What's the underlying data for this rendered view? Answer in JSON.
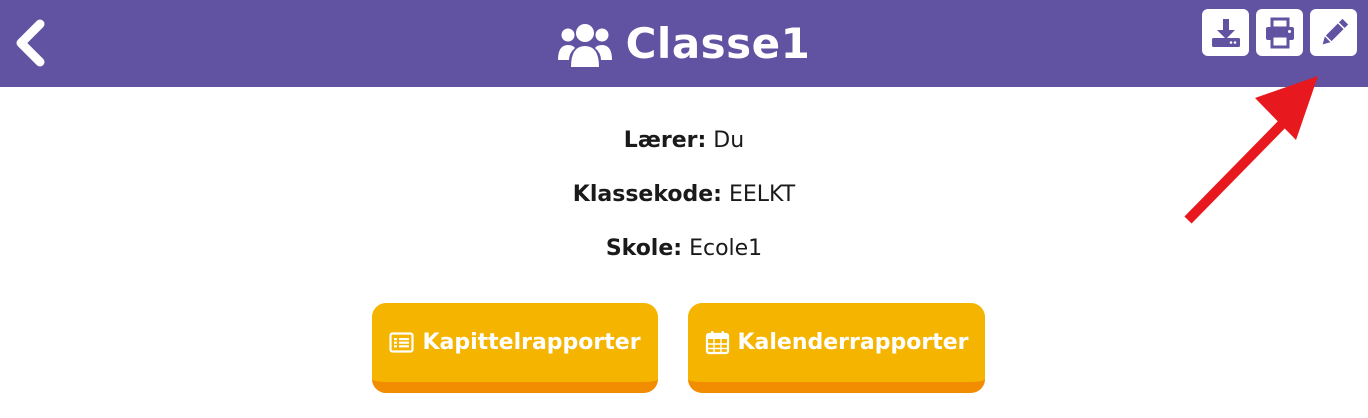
{
  "header": {
    "title": "Classe1",
    "background_color": "#6252a2",
    "icons": {
      "back": "chevron-left-icon",
      "group": "users-group-icon",
      "download": "download-icon",
      "print": "printer-icon",
      "edit": "pencil-icon"
    }
  },
  "info": {
    "teacher_label": "Lærer:",
    "teacher_value": "Du",
    "code_label": "Klassekode:",
    "code_value": "EELKT",
    "school_label": "Skole:",
    "school_value": "Ecole1"
  },
  "buttons": {
    "chapter_reports": "Kapittelrapporter",
    "calendar_reports": "Kalenderrapporter",
    "fill_color": "#f4b400",
    "shadow_color": "#f28c00"
  },
  "annotation": {
    "arrow_color": "#e8191e"
  }
}
